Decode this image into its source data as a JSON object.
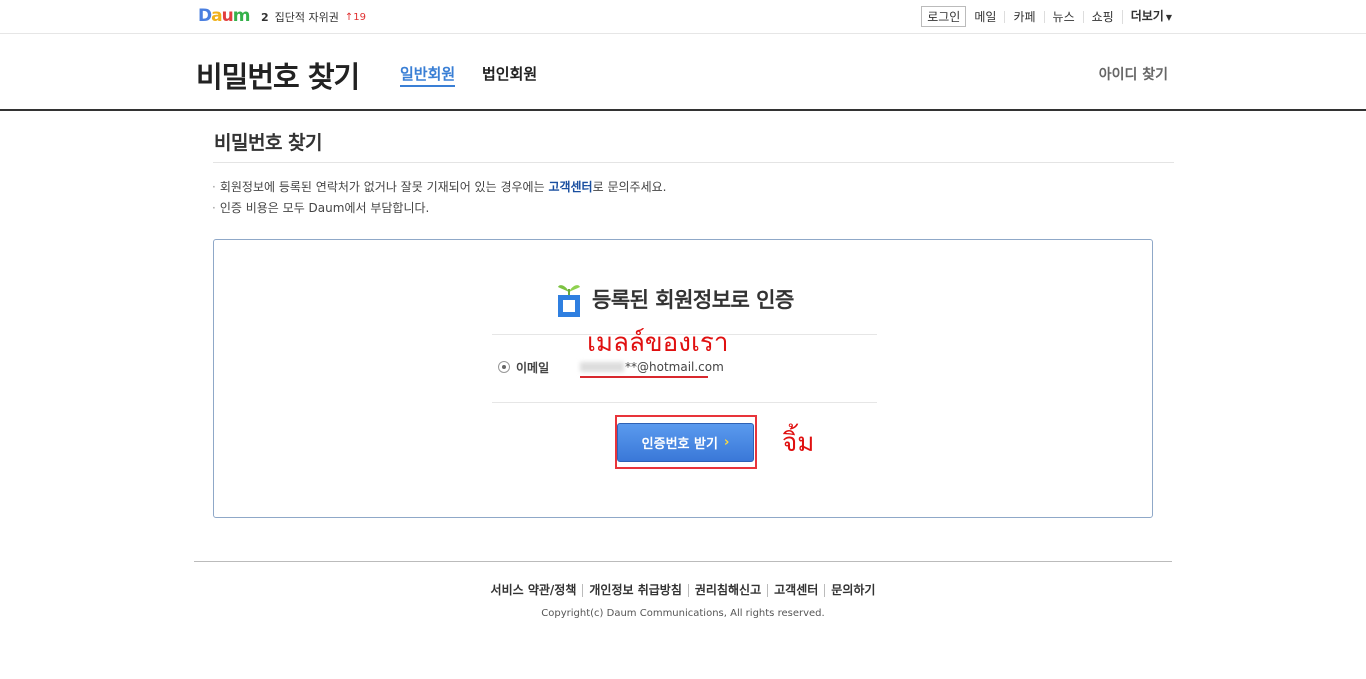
{
  "topbar": {
    "logo": {
      "letters": [
        "D",
        "a",
        "u",
        "m"
      ],
      "colors": [
        "#4a7fe0",
        "#f0b11c",
        "#e23e3e",
        "#35b14a"
      ]
    },
    "rank": {
      "number": "2",
      "keyword": "집단적 자위권",
      "change": "19"
    },
    "nav": {
      "login": "로그인",
      "mail": "메일",
      "cafe": "카페",
      "news": "뉴스",
      "shopping": "쇼핑",
      "more": "더보기"
    }
  },
  "header": {
    "title": "비밀번호 찾기",
    "tab_personal": "일반회원",
    "tab_corporate": "법인회원",
    "find_id": "아이디 찾기"
  },
  "section": {
    "title": "비밀번호 찾기",
    "notice1_pre": "회원정보에 등록된 연락처가 없거나 잘못 기재되어 있는 경우에는 ",
    "notice1_link": "고객센터",
    "notice1_post": "로 문의주세요.",
    "notice2": "인증 비용은 모두 Daum에서 부담합니다."
  },
  "auth": {
    "title": "등록된 회원정보로 인증",
    "email_label": "이메일",
    "email_value": "**@hotmail.com",
    "button_label": "인증번호 받기",
    "button_arrow": "›"
  },
  "annotations": {
    "mail": "เมลล์ของเรา",
    "click": "จิ้ม",
    "color": "#e01010"
  },
  "footer": {
    "links": [
      "서비스 약관/정책",
      "개인정보 취급방침",
      "권리침해신고",
      "고객센터",
      "문의하기"
    ],
    "copyright": "Copyright(c) Daum Communications, All rights reserved."
  }
}
